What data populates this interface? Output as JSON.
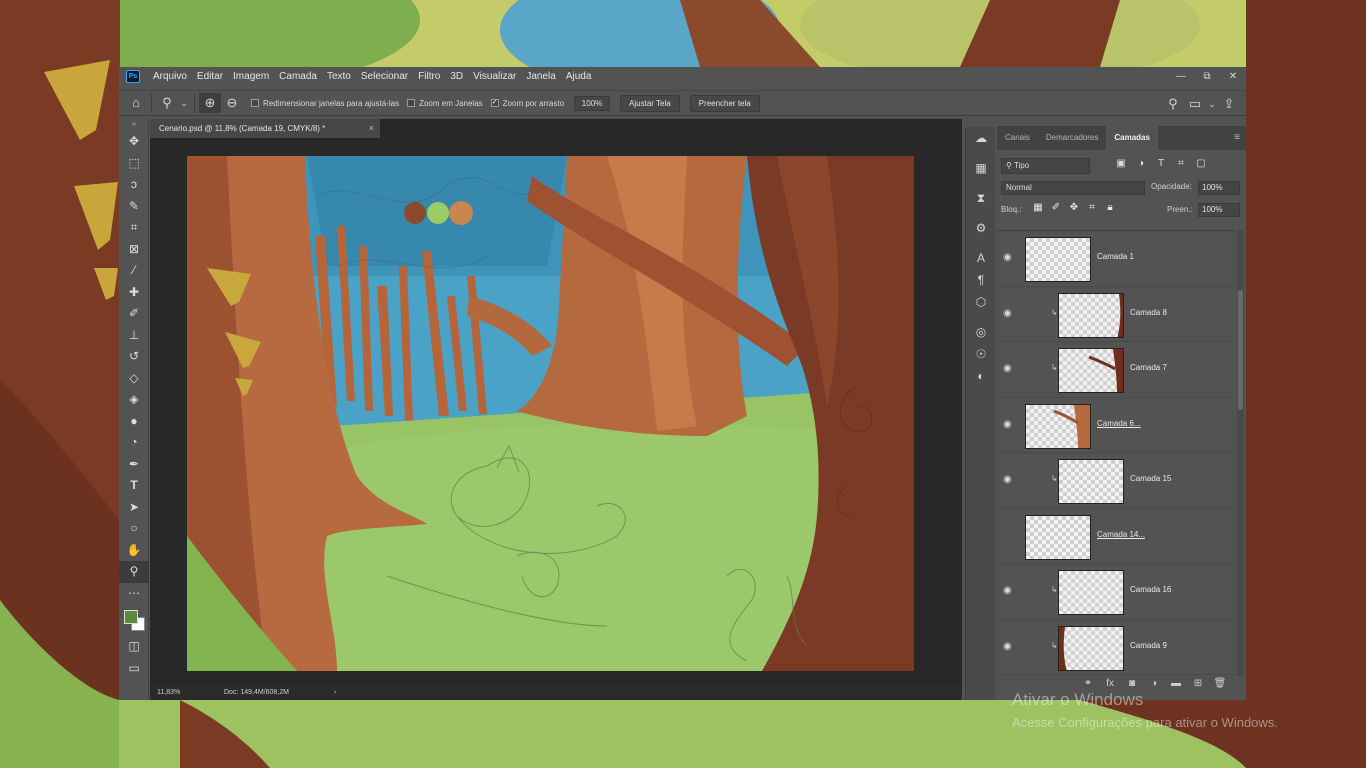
{
  "menu": {
    "items": [
      "Arquivo",
      "Editar",
      "Imagem",
      "Camada",
      "Texto",
      "Selecionar",
      "Filtro",
      "3D",
      "Visualizar",
      "Janela",
      "Ajuda"
    ]
  },
  "app_logo": "Ps",
  "window_controls": [
    "—",
    "⧉",
    "✕"
  ],
  "options": {
    "resize_windows": "Redimensionar janelas para ajustá-las",
    "zoom_all": "Zoom em Janelas",
    "scrubby_zoom": "Zoom por arrasto",
    "zoom_value": "100%",
    "fit_screen": "Ajustar Tela",
    "fill_screen": "Preencher tela"
  },
  "document": {
    "tab_title": "Cenario.psd @ 11,8% (Camada 19, CMYK/8) *",
    "close": "×",
    "status_zoom": "11,83%",
    "status_doc": "Doc: 149,4M/608,2M",
    "status_arrow": "›"
  },
  "tools": [
    "move-icon",
    "marquee-icon",
    "lasso-icon",
    "quick-select-icon",
    "crop-icon",
    "frame-icon",
    "eyedropper-icon",
    "healing-icon",
    "brush-icon",
    "stamp-icon",
    "history-brush-icon",
    "eraser-icon",
    "paint-bucket-icon",
    "blur-icon",
    "dodge-icon",
    "pen-icon",
    "type-icon",
    "path-select-icon",
    "ellipse-icon",
    "hand-icon",
    "zoom-icon",
    "more-icon"
  ],
  "colors": {
    "foreground": "#5c8a3c",
    "background": "#ffffff",
    "accent": "#31a8ff"
  },
  "layers_panel": {
    "tabs": [
      "Canais",
      "Demarcadores",
      "Camadas"
    ],
    "active_tab": "Camadas",
    "filter_kind": "Tipo",
    "blend_mode": "Normal",
    "opacity_label": "Opacidade:",
    "opacity": "100%",
    "lock_label": "Bloq.:",
    "fill_label": "Preen.:",
    "fill": "100%",
    "layers": [
      {
        "name": "Camada 1",
        "clipped": false,
        "group": false,
        "visible": true
      },
      {
        "name": "Camada 8",
        "clipped": true,
        "group": false,
        "visible": true
      },
      {
        "name": "Camada 7",
        "clipped": true,
        "group": false,
        "visible": true
      },
      {
        "name": "Camada 6...",
        "clipped": false,
        "group": true,
        "visible": true
      },
      {
        "name": "Camada 15",
        "clipped": true,
        "group": false,
        "visible": true
      },
      {
        "name": "Camada 14...",
        "clipped": false,
        "group": true,
        "visible": false
      },
      {
        "name": "Camada 16",
        "clipped": true,
        "group": false,
        "visible": true
      },
      {
        "name": "Camada 9",
        "clipped": true,
        "group": false,
        "visible": true
      }
    ]
  },
  "watermark": {
    "title": "Ativar o Windows",
    "subtitle": "Acesse Configurações para ativar o Windows."
  }
}
